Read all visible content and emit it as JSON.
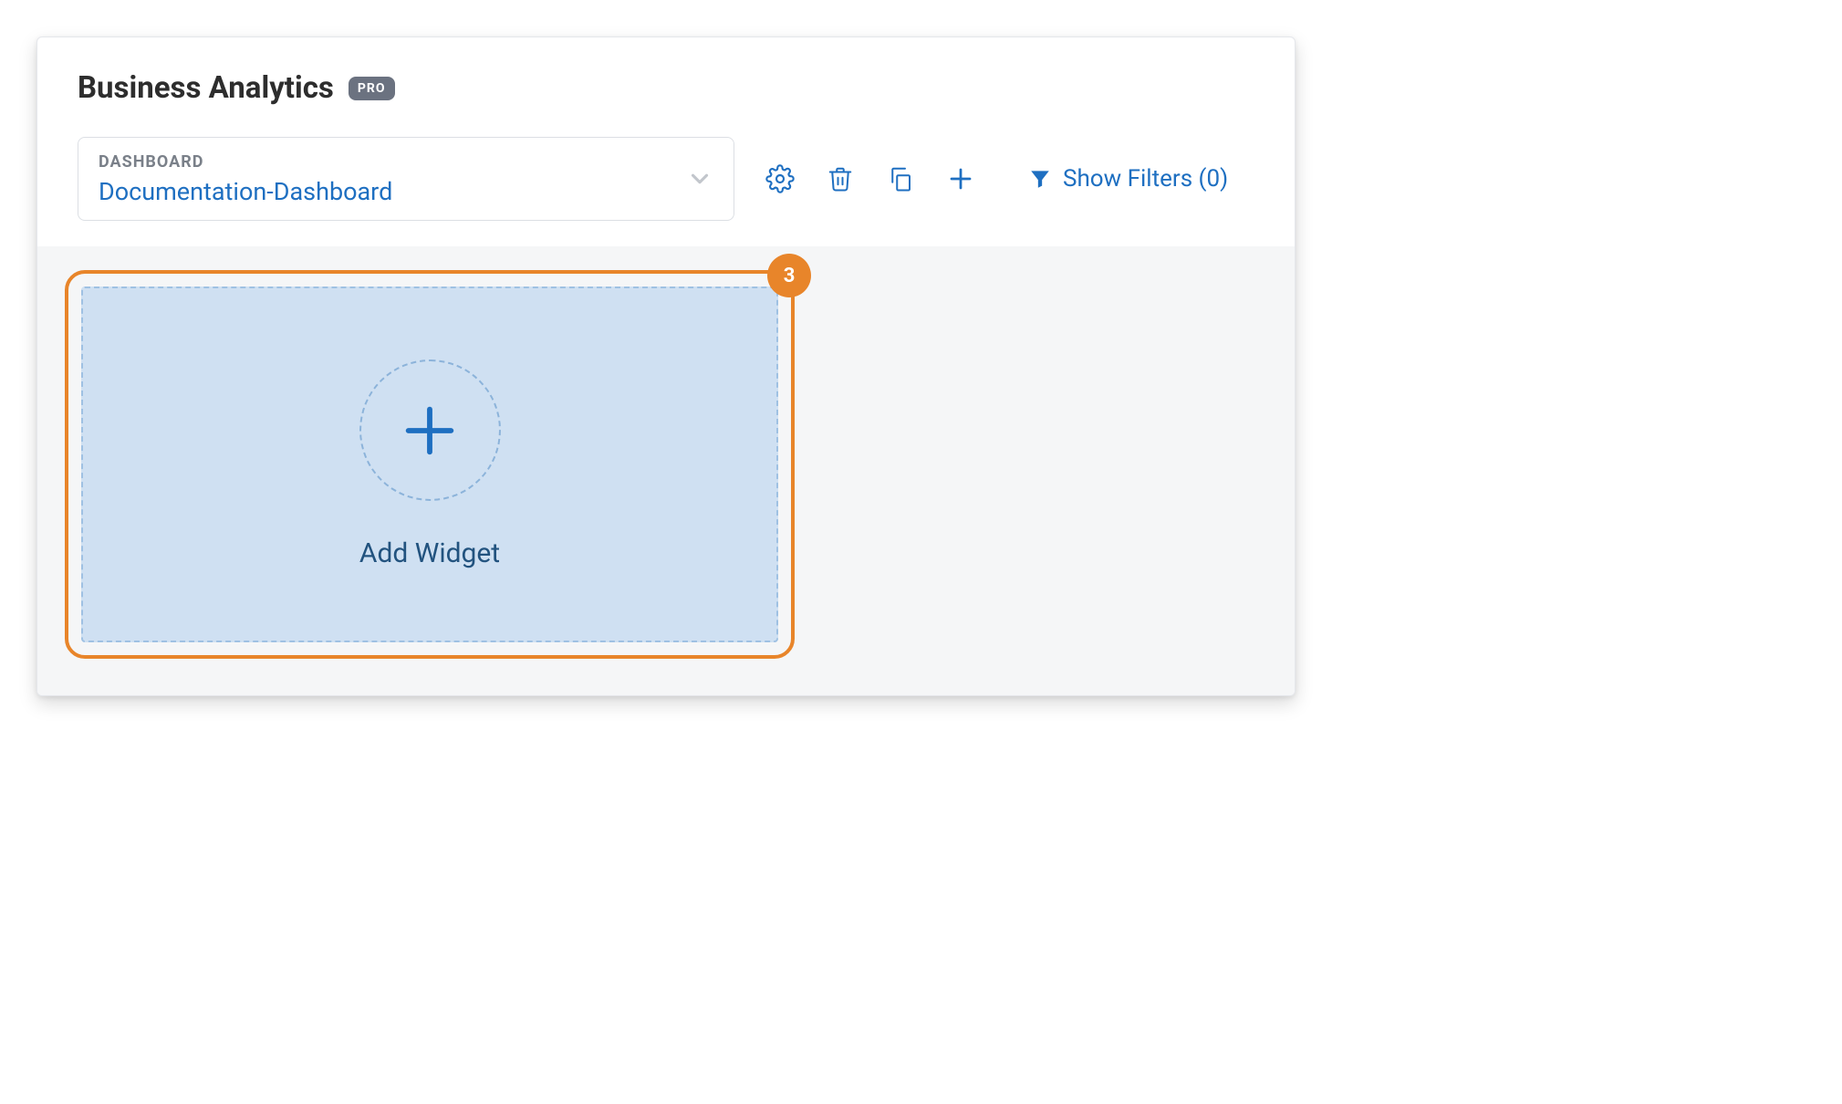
{
  "header": {
    "title": "Business Analytics",
    "badge": "PRO"
  },
  "dashboard_select": {
    "kicker": "DASHBOARD",
    "value": "Documentation-Dashboard"
  },
  "toolbar": {
    "settings_icon": "gear-icon",
    "delete_icon": "trash-icon",
    "copy_icon": "copy-icon",
    "add_icon": "plus-icon"
  },
  "filters": {
    "label": "Show Filters (0)"
  },
  "highlight": {
    "step": "3"
  },
  "add_widget": {
    "label": "Add Widget"
  },
  "colors": {
    "accent": "#1e6fc1",
    "highlight": "#e8852a"
  }
}
